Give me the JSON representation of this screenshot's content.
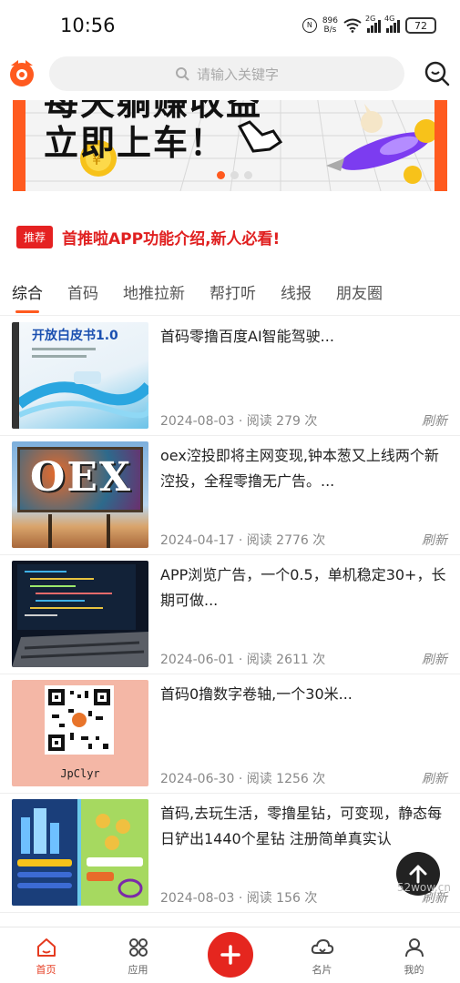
{
  "status_bar": {
    "time": "10:56",
    "net_speed_value": "896",
    "net_speed_unit": "B/s",
    "sim1_label": "2G",
    "sim2_label": "4G",
    "battery": "72"
  },
  "header": {
    "search_placeholder": "请输入关键字"
  },
  "banner": {
    "line1": "每天躺赚收益",
    "line2": "立即上车！",
    "coin_symbol": "¥",
    "slide_count": 3,
    "active_slide": 1
  },
  "notice": {
    "tag": "推荐",
    "text": "首推啦APP功能介绍,新人必看!"
  },
  "tabs": [
    {
      "label": "综合",
      "active": true
    },
    {
      "label": "首码",
      "active": false
    },
    {
      "label": "地推拉新",
      "active": false
    },
    {
      "label": "帮打听",
      "active": false
    },
    {
      "label": "线报",
      "active": false
    },
    {
      "label": "朋友圈",
      "active": false
    }
  ],
  "articles": [
    {
      "title": "首码零撸百度AI智能驾驶...",
      "date": "2024-08-03",
      "reads": "阅读 279 次",
      "refresh": "刷新",
      "thumb_text": "开放白皮书1.0"
    },
    {
      "title": "oex涳投即将主网变现,钟本葱又上线两个新涳投，全程零撸无广告。...",
      "date": "2024-04-17",
      "reads": "阅读 2776 次",
      "refresh": "刷新",
      "thumb_text": "OEX"
    },
    {
      "title": "APP浏览广告，一个0.5，单机稳定30+，长期可做...",
      "date": "2024-06-01",
      "reads": "阅读 2611 次",
      "refresh": "刷新",
      "thumb_text": ""
    },
    {
      "title": "首码0撸数字卷轴,一个30米...",
      "date": "2024-06-30",
      "reads": "阅读 1256 次",
      "refresh": "刷新",
      "thumb_text": "JpClyr"
    },
    {
      "title": "首码,去玩生活，零撸星钻，可变现，静态每日铲出1440个星钻 注册简单真实认",
      "date": "2024-08-03",
      "reads": "阅读 156 次",
      "refresh": "刷新",
      "thumb_text": ""
    }
  ],
  "bottom_nav": [
    {
      "label": "首页",
      "icon": "home-icon",
      "active": true
    },
    {
      "label": "应用",
      "icon": "apps-icon",
      "active": false
    },
    {
      "label": "",
      "icon": "plus-icon",
      "active": false
    },
    {
      "label": "名片",
      "icon": "card-cloud-icon",
      "active": false
    },
    {
      "label": "我的",
      "icon": "user-icon",
      "active": false
    }
  ],
  "watermark": "52wow.cn",
  "colors": {
    "accent": "#ff5a1f",
    "notice_red": "#e02020",
    "nav_active": "#e53a1f",
    "add_button": "#e5261f"
  }
}
